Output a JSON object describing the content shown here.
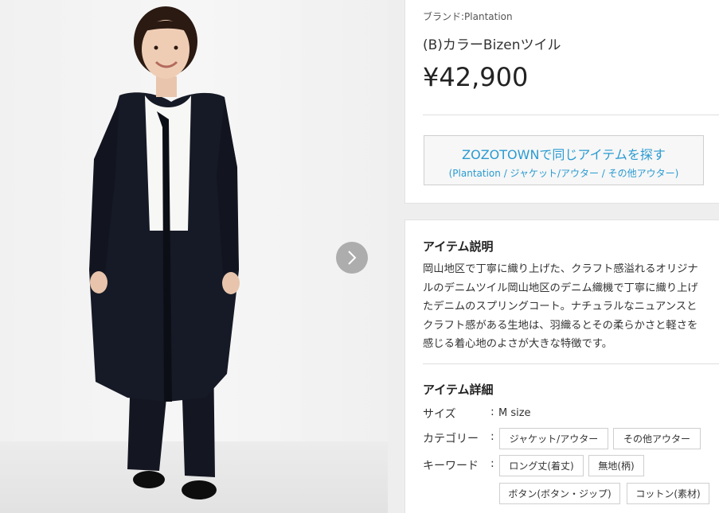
{
  "product": {
    "brand_label": "ブランド:",
    "brand_name": "Plantation",
    "title": "(B)カラーBizenツイル",
    "price": "¥42,900"
  },
  "zozo": {
    "main": "ZOZOTOWNで同じアイテムを探す",
    "sub": "(Plantation / ジャケット/アウター / その他アウター)"
  },
  "description": {
    "heading": "アイテム説明",
    "lines": [
      "岡山地区で丁寧に織り上げた、クラフト感溢れるオリジナ",
      "ルのデニムツイル岡山地区のデニム織機で丁寧に織り上げ",
      "たデニムのスプリングコート。ナチュラルなニュアンスと",
      "クラフト感がある生地は、羽織るとその柔らかさと軽さを",
      "感じる着心地のよさが大きな特徴です。"
    ]
  },
  "details": {
    "heading": "アイテム詳細",
    "size_label": "サイズ",
    "size_value": "M size",
    "category_label": "カテゴリー",
    "keyword_label": "キーワード",
    "colon": ":",
    "categories": [
      "ジャケット/アウター",
      "その他アウター"
    ],
    "keywords": [
      "ロング丈(着丈)",
      "無地(柄)",
      "ボタン(ボタン・ジップ)",
      "コットン(素材)"
    ]
  },
  "icons": {
    "next": "chevron-right-icon"
  },
  "colors": {
    "accent": "#2a9bd1",
    "coat": "#161a26"
  }
}
